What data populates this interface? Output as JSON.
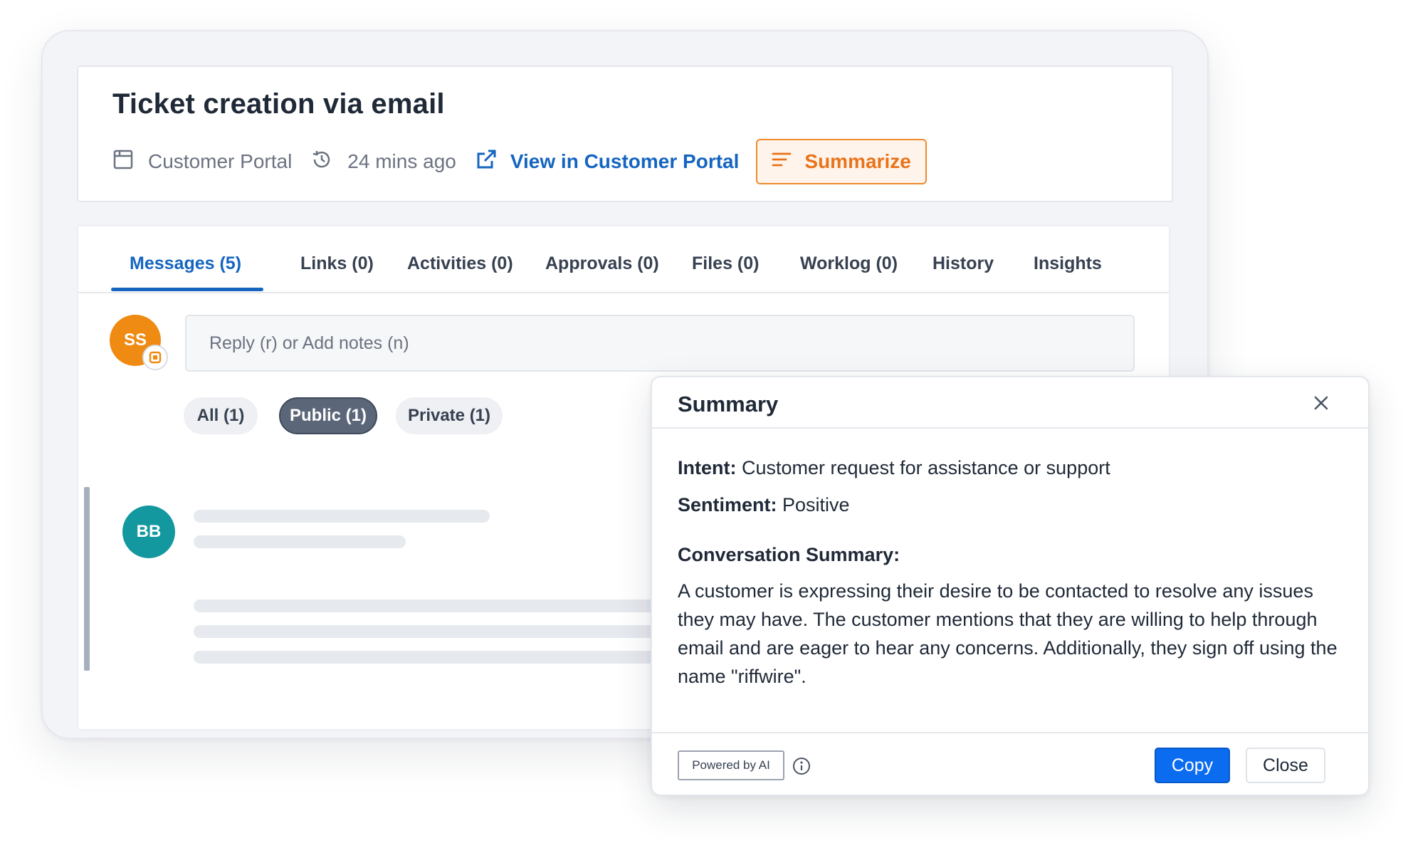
{
  "ticket": {
    "title": "Ticket creation via email",
    "source": "Customer Portal",
    "time_ago": "24 mins ago",
    "view_link": "View in Customer Portal",
    "summarize_label": "Summarize"
  },
  "tabs": [
    {
      "label": "Messages  (5)",
      "active": true
    },
    {
      "label": "Links (0)"
    },
    {
      "label": "Activities (0)"
    },
    {
      "label": "Approvals (0)"
    },
    {
      "label": "Files (0)"
    },
    {
      "label": "Worklog (0)"
    },
    {
      "label": "History"
    },
    {
      "label": "Insights"
    }
  ],
  "composer": {
    "avatar_initials": "SS",
    "placeholder": "Reply (r) or Add notes (n)"
  },
  "filters": [
    {
      "label": "All (1)"
    },
    {
      "label": "Public (1)",
      "selected": true
    },
    {
      "label": "Private (1)"
    }
  ],
  "thread": {
    "avatar_initials": "BB"
  },
  "summary": {
    "title": "Summary",
    "intent_label": "Intent:",
    "intent_value": " Customer request for assistance or support",
    "sentiment_label": "Sentiment:",
    "sentiment_value": " Positive",
    "conversation_heading": "Conversation Summary:",
    "conversation_text": "A customer is expressing their desire to be contacted to resolve any issues they may have. The customer mentions that they are willing to help through email and are eager to hear any concerns. Additionally, they sign off using the name \"riffwire\".",
    "powered_label": "Powered by AI",
    "copy_label": "Copy",
    "close_label": "Close"
  },
  "colors": {
    "brand_blue": "#1565c0",
    "summarize_orange": "#e8731a",
    "copy_button": "#0b6cf0",
    "avatar_ss": "#ef8a13",
    "avatar_bb": "#13989f",
    "pill_selected": "#5b6678"
  },
  "icons": [
    "calendar-icon",
    "history-icon",
    "external-link-icon",
    "summarize-lines-icon",
    "portal-badge-icon",
    "close-icon",
    "info-icon"
  ]
}
